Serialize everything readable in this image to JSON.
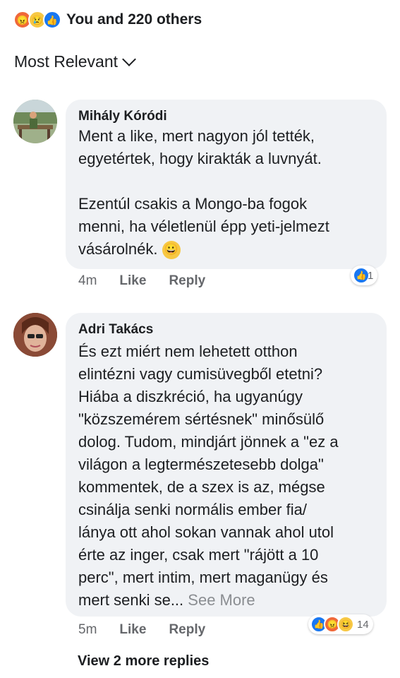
{
  "reactions": {
    "icons": [
      "angry-icon",
      "sad-icon",
      "like-icon"
    ],
    "summary": "You and 220 others"
  },
  "sort": {
    "label": "Most Relevant"
  },
  "comments": [
    {
      "author": "Mihály Kóródi",
      "lines": [
        "Ment a like, mert nagyon jól tették,",
        "egyetértek, hogy kirakták a luvnyát.",
        "",
        "Ezentúl csakis a Mongo-ba fogok",
        "menni, ha véletlenül épp yeti-jelmezt",
        "vásárolnék."
      ],
      "time": "4m",
      "like": "Like",
      "reply": "Reply",
      "reaction_count": "1"
    },
    {
      "author": "Adri Takács",
      "lines": [
        "És ezt miért nem lehetett otthon",
        "elintézni vagy cumisüvegből etetni?",
        "Hiába a diszkréció, ha ugyanúgy",
        "\"közszemérem sértésnek\" minősülő",
        "dolog. Tudom, mindjárt jönnek a \"ez a",
        "világon a legtermészetesebb dolga\"",
        "kommentek, de a szex is az, mégse",
        "csinálja senki normális ember fia/",
        "lánya ott ahol sokan vannak ahol utol",
        "érte az inger, csak mert \"rájött a 10",
        "perc\", mert intim, mert maganügy és",
        "mert senki se..."
      ],
      "see_more": "See More",
      "time": "5m",
      "like": "Like",
      "reply": "Reply",
      "reaction_count": "14"
    }
  ],
  "view_more_replies": "View 2 more replies"
}
